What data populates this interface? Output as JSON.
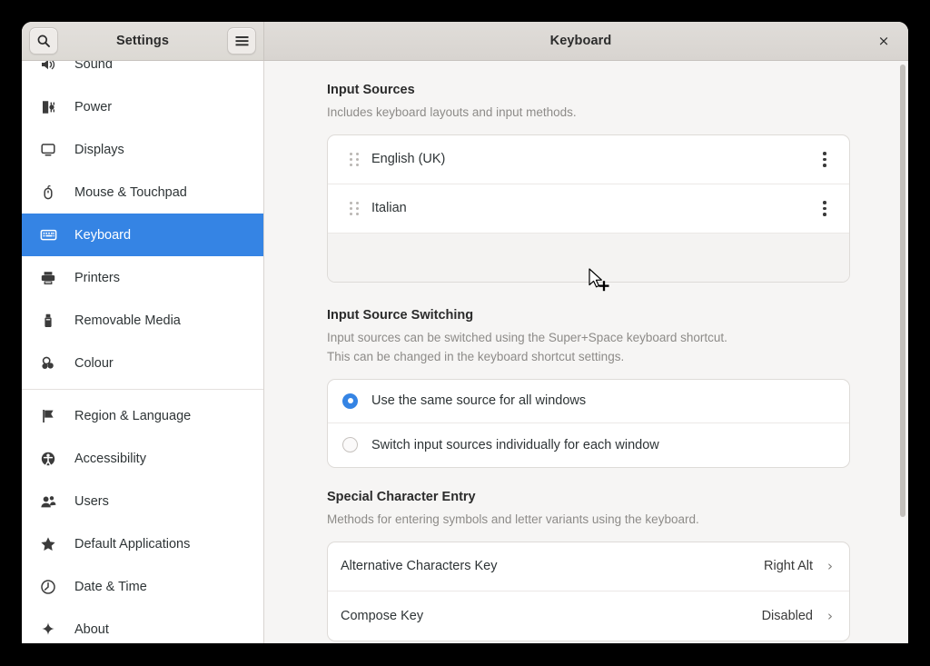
{
  "window": {
    "sidebar_title": "Settings",
    "panel_title": "Keyboard",
    "close_label": "×",
    "search_icon": "search-icon",
    "menu_icon": "hamburger-menu-icon"
  },
  "accent_color": "#3584e4",
  "sidebar": {
    "items": [
      {
        "label": "Sound",
        "icon": "speaker-icon",
        "selected": false,
        "separator_after": false
      },
      {
        "label": "Power",
        "icon": "power-plug-icon",
        "selected": false,
        "separator_after": false
      },
      {
        "label": "Displays",
        "icon": "monitor-icon",
        "selected": false,
        "separator_after": false
      },
      {
        "label": "Mouse & Touchpad",
        "icon": "mouse-icon",
        "selected": false,
        "separator_after": false
      },
      {
        "label": "Keyboard",
        "icon": "keyboard-icon",
        "selected": true,
        "separator_after": false
      },
      {
        "label": "Printers",
        "icon": "printer-icon",
        "selected": false,
        "separator_after": false
      },
      {
        "label": "Removable Media",
        "icon": "usb-drive-icon",
        "selected": false,
        "separator_after": false
      },
      {
        "label": "Colour",
        "icon": "colour-icon",
        "selected": false,
        "separator_after": true
      },
      {
        "label": "Region & Language",
        "icon": "flag-icon",
        "selected": false,
        "separator_after": false
      },
      {
        "label": "Accessibility",
        "icon": "accessibility-icon",
        "selected": false,
        "separator_after": false
      },
      {
        "label": "Users",
        "icon": "users-icon",
        "selected": false,
        "separator_after": false
      },
      {
        "label": "Default Applications",
        "icon": "star-icon",
        "selected": false,
        "separator_after": false
      },
      {
        "label": "Date & Time",
        "icon": "clock-icon",
        "selected": false,
        "separator_after": false
      },
      {
        "label": "About",
        "icon": "sparkle-icon",
        "selected": false,
        "separator_after": false
      }
    ]
  },
  "main": {
    "input_sources": {
      "title": "Input Sources",
      "description": "Includes keyboard layouts and input methods.",
      "items": [
        {
          "label": "English (UK)",
          "menu_icon": "three-dots-vertical-icon",
          "drag_icon": "drag-handle-icon"
        },
        {
          "label": "Italian",
          "menu_icon": "three-dots-vertical-icon",
          "drag_icon": "drag-handle-icon"
        }
      ],
      "add_label": "+"
    },
    "input_source_switching": {
      "title": "Input Source Switching",
      "description_line1": "Input sources can be switched using the Super+Space keyboard shortcut.",
      "description_line2": "This can be changed in the keyboard shortcut settings.",
      "options": [
        {
          "label": "Use the same source for all windows",
          "selected": true
        },
        {
          "label": "Switch input sources individually for each window",
          "selected": false
        }
      ]
    },
    "special_character_entry": {
      "title": "Special Character Entry",
      "description": "Methods for entering symbols and letter variants using the keyboard.",
      "rows": [
        {
          "label": "Alternative Characters Key",
          "value": "Right Alt",
          "chevron": "chevron-right-icon"
        },
        {
          "label": "Compose Key",
          "value": "Disabled",
          "chevron": "chevron-right-icon"
        }
      ]
    }
  },
  "cursor": {
    "type": "arrow-plus-cursor"
  }
}
